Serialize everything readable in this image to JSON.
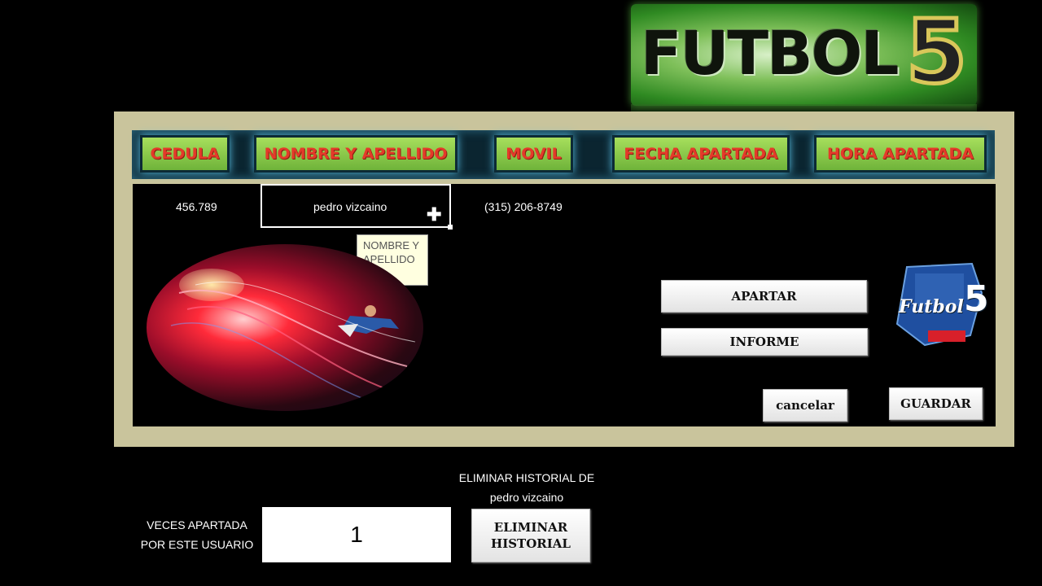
{
  "logo": {
    "text": "FUTBOL",
    "number": "5"
  },
  "headers": {
    "cedula": "CEDULA",
    "nombre": "NOMBRE Y APELLIDO",
    "movil": "MOVIL",
    "fecha": "FECHA APARTADA",
    "hora": "HORA APARTADA"
  },
  "record": {
    "cedula": "456.789",
    "nombre": "pedro vizcaino",
    "movil": "(315) 206-8749"
  },
  "tooltip": "NOMBRE Y APELLIDO",
  "buttons": {
    "apartar": "APARTAR",
    "informe": "INFORME",
    "cancelar": "cancelar",
    "guardar": "GUARDAR",
    "eliminar_line1": "ELIMINAR",
    "eliminar_line2": "HISTORIAL"
  },
  "small_logo": {
    "text": "Futbol",
    "number": "5"
  },
  "eliminar_label": {
    "line1": "ELIMINAR HISTORIAL DE",
    "line2": "pedro vizcaino"
  },
  "veces_label": {
    "line1": "VECES APARTADA",
    "line2": "POR ESTE USUARIO"
  },
  "veces_value": "1",
  "colors": {
    "panel": "#c9c49c",
    "header_button": "#8fd04a",
    "header_text": "#e43a2a",
    "header_bar": "#0b2530"
  }
}
